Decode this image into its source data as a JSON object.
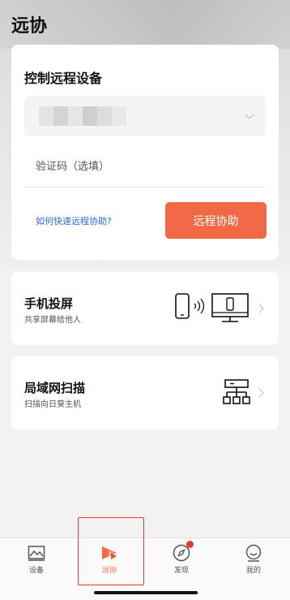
{
  "header": {
    "title": "远协"
  },
  "remote_control": {
    "title": "控制远程设备",
    "device_select": {
      "value": ""
    },
    "code_input": {
      "placeholder": "验证码（选填）",
      "value": ""
    },
    "help_link": "如何快速远程协助?",
    "assist_button": "远程协助"
  },
  "features": [
    {
      "title": "手机投屏",
      "subtitle": "共享屏幕给他人",
      "icon": "phone-to-monitor-icon"
    },
    {
      "title": "局域网扫描",
      "subtitle": "扫描向日葵主机",
      "icon": "network-topology-icon"
    }
  ],
  "tabbar": {
    "items": [
      {
        "label": "设备",
        "icon": "landscape-image-icon",
        "active": false
      },
      {
        "label": "远协",
        "icon": "remote-assist-icon",
        "active": true
      },
      {
        "label": "发现",
        "icon": "compass-icon",
        "active": false,
        "badge": true
      },
      {
        "label": "我的",
        "icon": "smiley-face-icon",
        "active": false
      }
    ]
  },
  "colors": {
    "accent": "#f26a45",
    "link": "#2a6bd8",
    "badge": "#e53935",
    "highlight_box": "#e53935"
  }
}
